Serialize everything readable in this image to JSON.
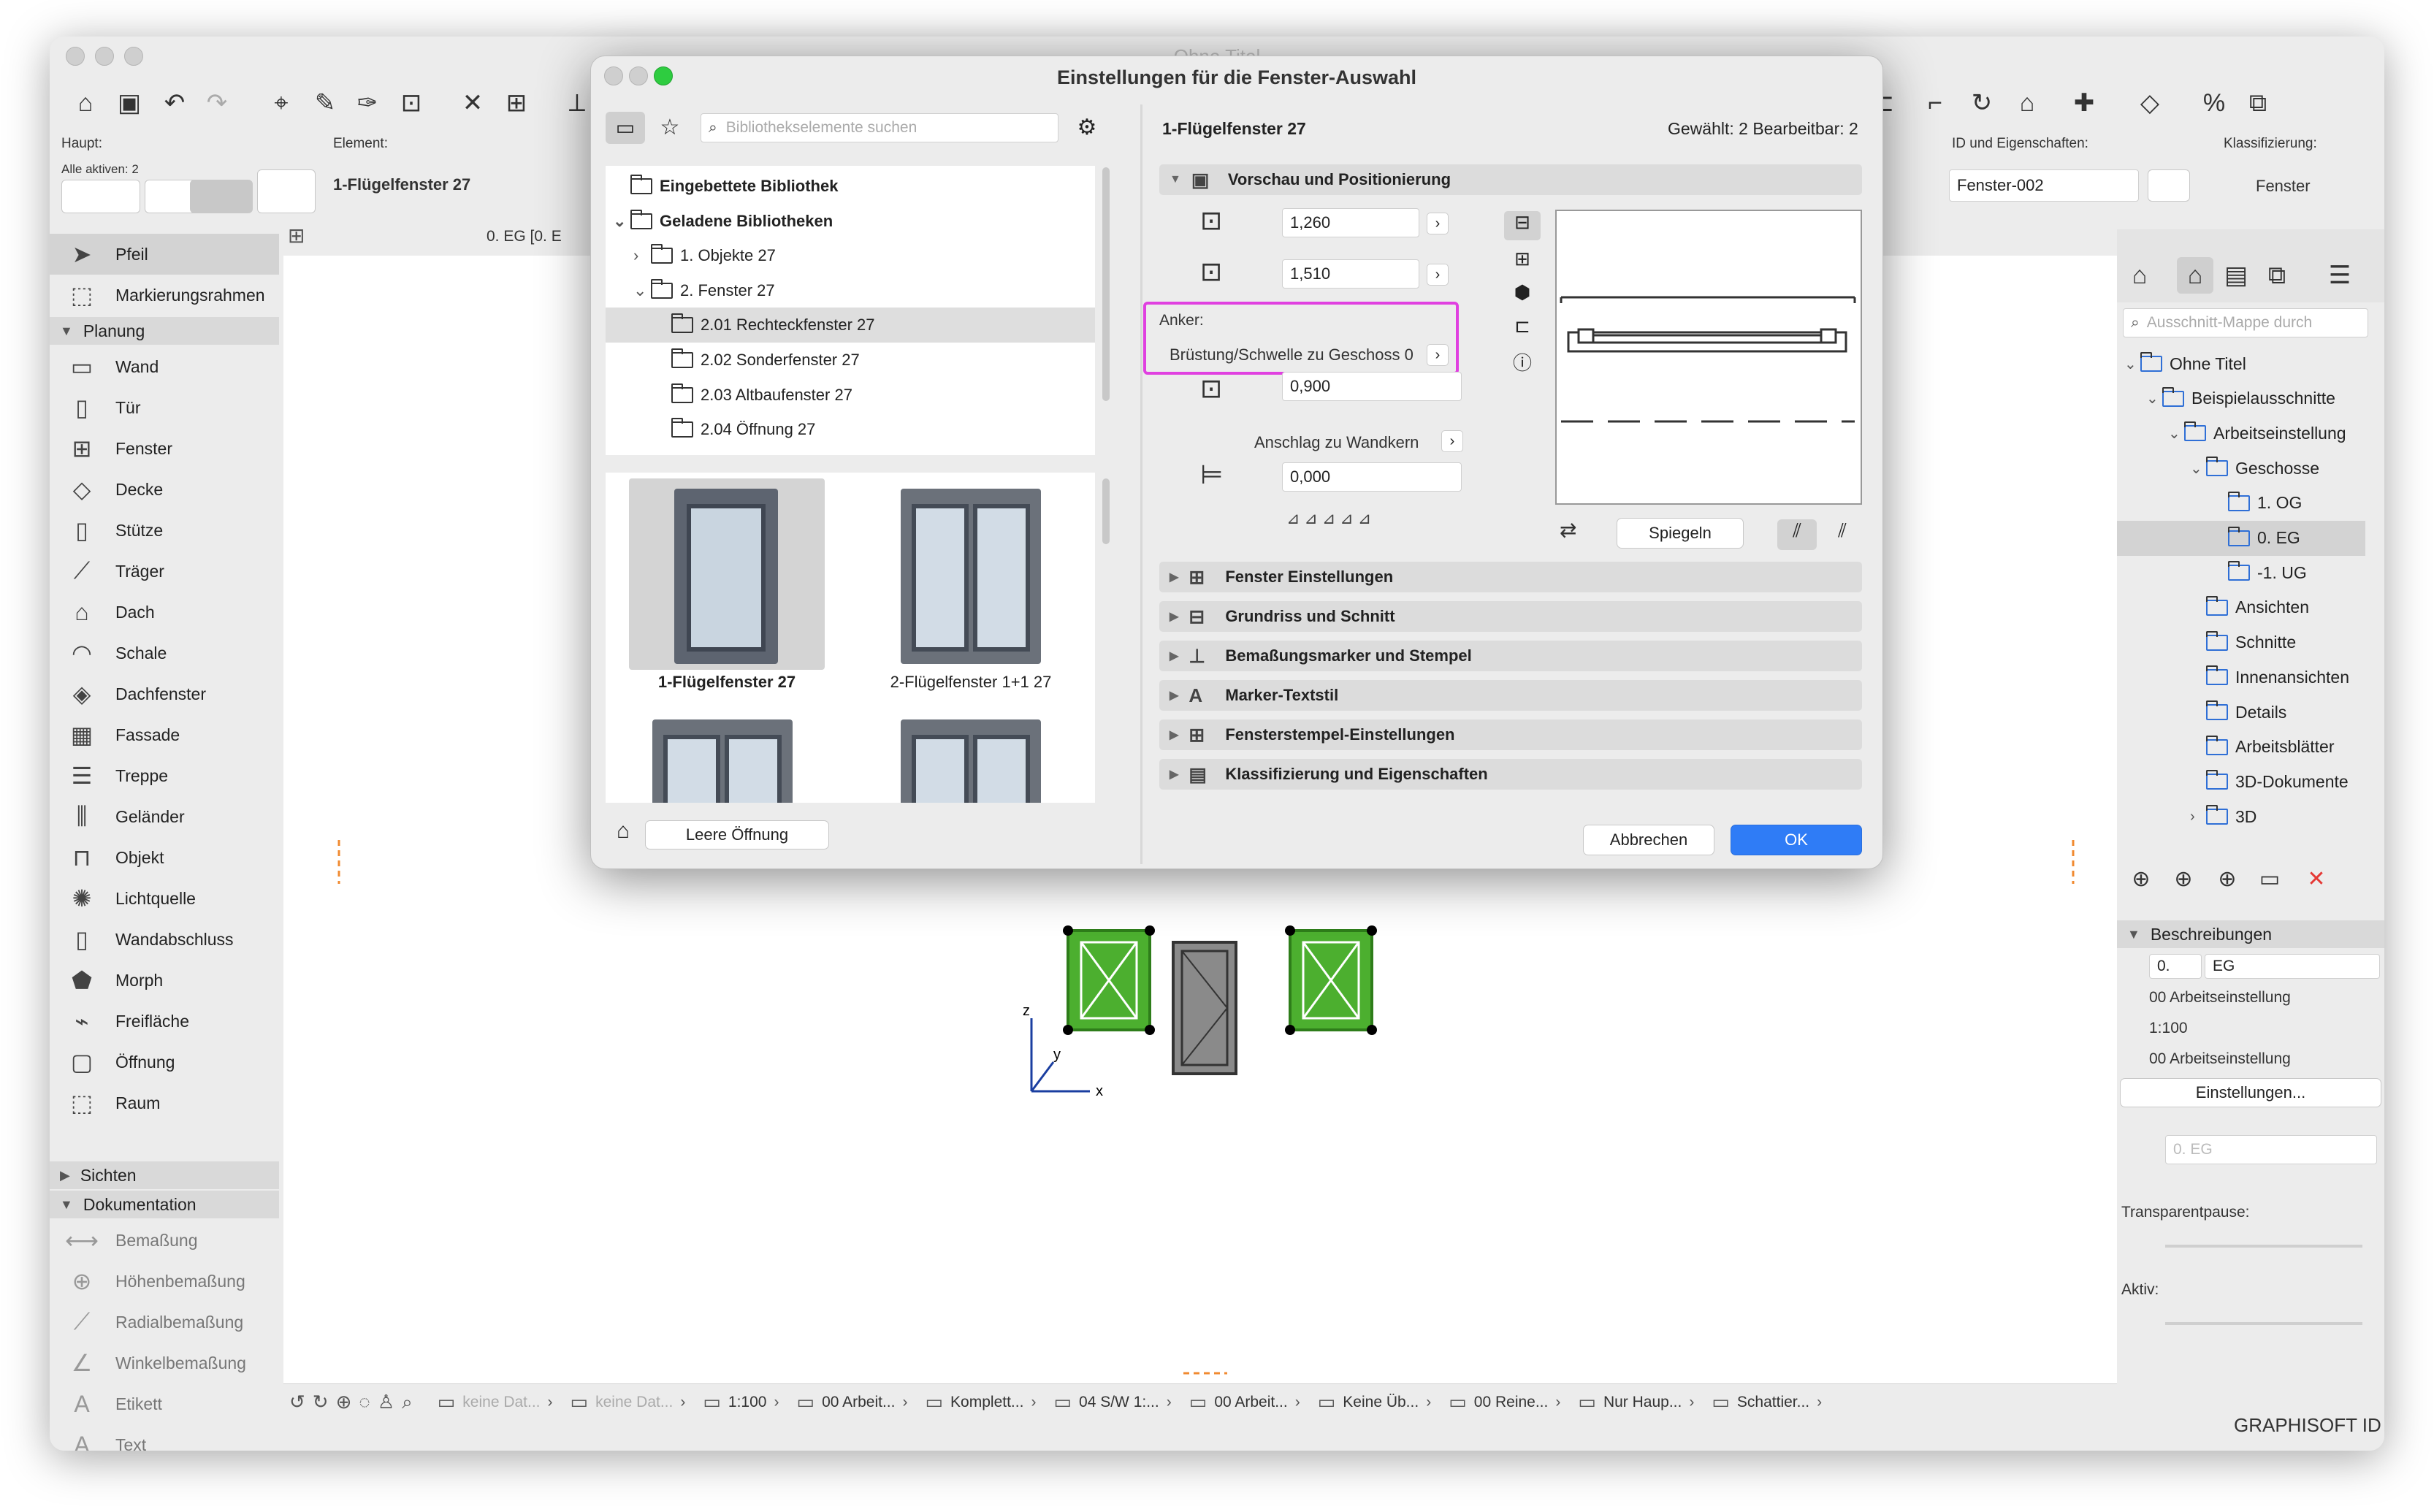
{
  "app": {
    "title": "Ohne Titel"
  },
  "infobox": {
    "haupt_label": "Haupt:",
    "alle_aktiven": "Alle aktiven: 2",
    "element_label": "Element:",
    "element_value": "1-Flügelfenster 27",
    "id_label": "ID und Eigenschaften:",
    "id_value": "Fenster-002",
    "klass_label": "Klassifizierung:",
    "klass_value": "Fenster",
    "story_tab": "0. EG [0. E"
  },
  "toolbox": {
    "arrow": "Pfeil",
    "marquee": "Markierungsrahmen",
    "section_planung": "Planung",
    "planung_items": [
      "Wand",
      "Tür",
      "Fenster",
      "Decke",
      "Stütze",
      "Träger",
      "Dach",
      "Schale",
      "Dachfenster",
      "Fassade",
      "Treppe",
      "Geländer",
      "Objekt",
      "Lichtquelle",
      "Wandabschluss",
      "Morph",
      "Freifläche",
      "Öffnung",
      "Raum"
    ],
    "section_sichten": "Sichten",
    "section_doku": "Dokumentation",
    "doku_items": [
      "Bemaßung",
      "Höhenbemaßung",
      "Radialbemaßung",
      "Winkelbemaßung",
      "Etikett",
      "Text"
    ]
  },
  "navigator": {
    "search_placeholder": "Ausschnitt-Mappe durch",
    "tree": [
      {
        "label": "Ohne Titel",
        "level": 0,
        "expand": "open"
      },
      {
        "label": "Beispielausschnitte",
        "level": 1,
        "expand": "open"
      },
      {
        "label": "Arbeitseinstellung",
        "level": 2,
        "expand": "open"
      },
      {
        "label": "Geschosse",
        "level": 3,
        "expand": "open"
      },
      {
        "label": "1. OG",
        "level": 4,
        "expand": ""
      },
      {
        "label": "0. EG",
        "level": 4,
        "expand": "",
        "selected": true
      },
      {
        "label": "-1. UG",
        "level": 4,
        "expand": ""
      },
      {
        "label": "Ansichten",
        "level": 3,
        "expand": ""
      },
      {
        "label": "Schnitte",
        "level": 3,
        "expand": ""
      },
      {
        "label": "Innenansichten",
        "level": 3,
        "expand": ""
      },
      {
        "label": "Details",
        "level": 3,
        "expand": ""
      },
      {
        "label": "Arbeitsblätter",
        "level": 3,
        "expand": ""
      },
      {
        "label": "3D-Dokumente",
        "level": 3,
        "expand": ""
      },
      {
        "label": "3D",
        "level": 3,
        "expand": "closed"
      }
    ],
    "beschreibungen": "Beschreibungen",
    "story_num": "0.",
    "story_name": "EG",
    "layer": "00 Arbeitseinstellung",
    "scale": "1:100",
    "modelview": "00 Arbeitseinstellung",
    "settings_btn": "Einstellungen...",
    "layout_story": "0. EG",
    "transparent_label": "Transparentpause:",
    "aktiv_label": "Aktiv:",
    "brand": "GRAPHISOFT ID"
  },
  "statusbar": {
    "items": [
      "keine Dat...",
      "keine Dat...",
      "1:100",
      "00 Arbeit...",
      "Komplett...",
      "04 S/W 1:...",
      "00 Arbeit...",
      "Keine Üb...",
      "00 Reine...",
      "Nur Haup...",
      "Schattier..."
    ]
  },
  "dialog": {
    "title": "Einstellungen für die Fenster-Auswahl",
    "search_placeholder": "Bibliothekselemente suchen",
    "lib_tree": [
      {
        "label": "Eingebettete Bibliothek",
        "level": 0,
        "bold": true,
        "expand": ""
      },
      {
        "label": "Geladene Bibliotheken",
        "level": 0,
        "bold": true,
        "expand": "open"
      },
      {
        "label": "1. Objekte 27",
        "level": 1,
        "bold": false,
        "expand": "closed"
      },
      {
        "label": "2. Fenster 27",
        "level": 1,
        "bold": false,
        "expand": "open"
      },
      {
        "label": "2.01 Rechteckfenster 27",
        "level": 2,
        "bold": false,
        "expand": "",
        "selected": true
      },
      {
        "label": "2.02 Sonderfenster 27",
        "level": 2,
        "bold": false,
        "expand": ""
      },
      {
        "label": "2.03 Altbaufenster 27",
        "level": 2,
        "bold": false,
        "expand": ""
      },
      {
        "label": "2.04 Öffnung 27",
        "level": 2,
        "bold": false,
        "expand": ""
      }
    ],
    "thumbs": [
      "1-Flügelfenster 27",
      "2-Flügelfenster 1+1 27"
    ],
    "empty_opening": "Leere Öffnung",
    "element_name": "1-Flügelfenster 27",
    "selection_info": "Gewählt: 2 Bearbeitbar: 2",
    "sections": [
      "Vorschau und Positionierung",
      "Fenster Einstellungen",
      "Grundriss und Schnitt",
      "Bemaßungsmarker und Stempel",
      "Marker-Textstil",
      "Fensterstempel-Einstellungen",
      "Klassifizierung und Eigenschaften"
    ],
    "width": "1,260",
    "height": "1,510",
    "anchor_label": "Anker:",
    "anchor_value": "Brüstung/Schwelle zu Geschoss 0",
    "sill_height": "0,900",
    "reveal_label": "Anschlag zu Wandkern",
    "reveal_value": "0,000",
    "mirror_btn": "Spiegeln",
    "cancel_btn": "Abbrechen",
    "ok_btn": "OK"
  },
  "colors": {
    "accent": "#2f7cf6",
    "highlight": "#e040e0",
    "window_green": "#4caf2f"
  }
}
